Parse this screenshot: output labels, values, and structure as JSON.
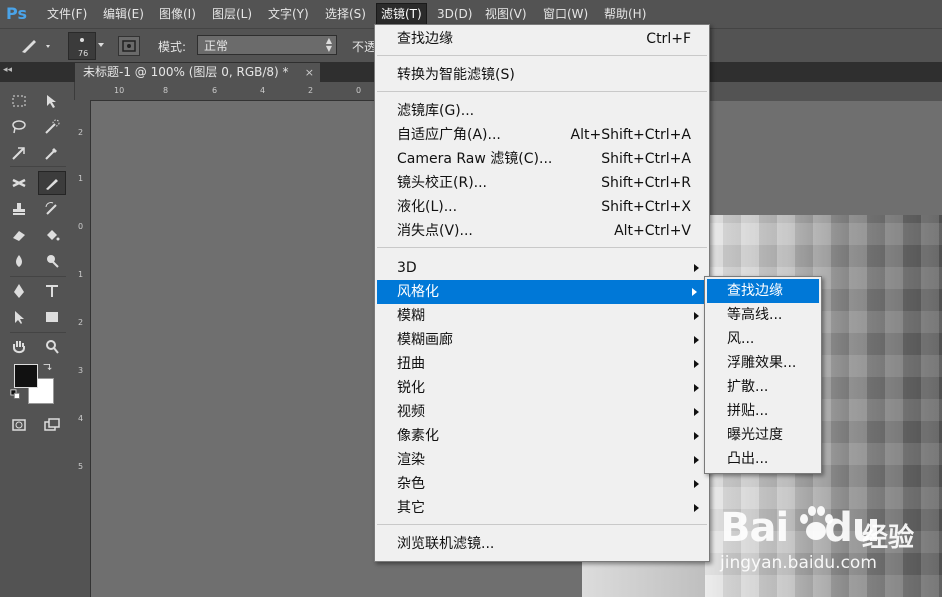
{
  "app": {
    "logo": "Ps"
  },
  "menubar": {
    "items": [
      "文件(F)",
      "编辑(E)",
      "图像(I)",
      "图层(L)",
      "文字(Y)",
      "选择(S)",
      "滤镜(T)",
      "3D(D)",
      "视图(V)",
      "窗口(W)",
      "帮助(H)"
    ]
  },
  "options_bar": {
    "brush_size": "76",
    "mode_label": "模式:",
    "mode_value": "正常",
    "opacity_label": "不透"
  },
  "tabbar": {
    "collapse": "◂◂",
    "document_tab": "未标题-1 @ 100% (图层 0, RGB/8) *",
    "close": "×"
  },
  "rulers": {
    "top": [
      "10",
      "8",
      "6",
      "4",
      "2",
      "0"
    ],
    "left": [
      "2",
      "1",
      "0",
      "1",
      "2",
      "3",
      "4",
      "5"
    ]
  },
  "filter_menu": {
    "last_filter": {
      "label": "查找边缘",
      "shortcut": "Ctrl+F"
    },
    "convert_smart": "转换为智能滤镜(S)",
    "group1": [
      {
        "label": "滤镜库(G)...",
        "shortcut": ""
      },
      {
        "label": "自适应广角(A)...",
        "shortcut": "Alt+Shift+Ctrl+A"
      },
      {
        "label": "Camera Raw 滤镜(C)...",
        "shortcut": "Shift+Ctrl+A"
      },
      {
        "label": "镜头校正(R)...",
        "shortcut": "Shift+Ctrl+R"
      },
      {
        "label": "液化(L)...",
        "shortcut": "Shift+Ctrl+X"
      },
      {
        "label": "消失点(V)...",
        "shortcut": "Alt+Ctrl+V"
      }
    ],
    "submenus": [
      "3D",
      "风格化",
      "模糊",
      "模糊画廊",
      "扭曲",
      "锐化",
      "视频",
      "像素化",
      "渲染",
      "杂色",
      "其它"
    ],
    "highlighted_submenu": "风格化",
    "browse_online": "浏览联机滤镜..."
  },
  "stylize_submenu": {
    "items": [
      "查找边缘",
      "等高线...",
      "风...",
      "浮雕效果...",
      "扩散...",
      "拼贴...",
      "曝光过度",
      "凸出..."
    ],
    "highlighted": "查找边缘"
  },
  "watermark": {
    "logo_text": "Bai",
    "logo_text2": "du",
    "jingyan": "经验",
    "url": "jingyan.baidu.com"
  },
  "colors": {
    "highlight": "#0078d7",
    "menu_bg": "#f0f0f0",
    "ui_bg": "#535353",
    "ps_blue": "#4aa3e8"
  }
}
